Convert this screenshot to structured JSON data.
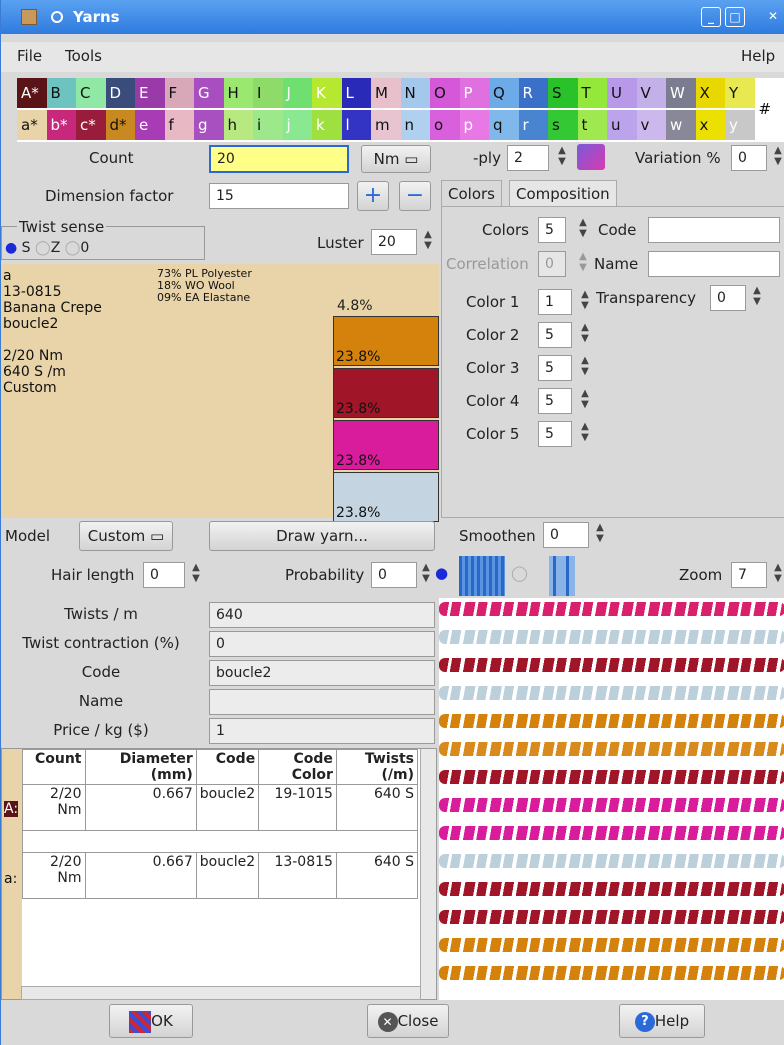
{
  "window": {
    "title": "Yarns"
  },
  "menu": {
    "file": "File",
    "tools": "Tools",
    "help": "Help"
  },
  "palette": {
    "upper": [
      {
        "l": "A*",
        "c": "#5a1418",
        "t": "#fff"
      },
      {
        "l": "B",
        "c": "#6cc3c0",
        "t": "#111"
      },
      {
        "l": "C",
        "c": "#8fe8a4",
        "t": "#111"
      },
      {
        "l": "D",
        "c": "#3a4d7a",
        "t": "#fff"
      },
      {
        "l": "E",
        "c": "#9a3aa8",
        "t": "#fff"
      },
      {
        "l": "F",
        "c": "#d8a8b8",
        "t": "#111"
      },
      {
        "l": "G",
        "c": "#a84ec0",
        "t": "#fff"
      },
      {
        "l": "H",
        "c": "#9ae870",
        "t": "#111"
      },
      {
        "l": "I",
        "c": "#8edb6a",
        "t": "#111"
      },
      {
        "l": "J",
        "c": "#6fe06f",
        "t": "#fff"
      },
      {
        "l": "K",
        "c": "#b6e830",
        "t": "#fff"
      },
      {
        "l": "L",
        "c": "#2a2ab8",
        "t": "#fff"
      },
      {
        "l": "M",
        "c": "#e8c0cc",
        "t": "#111"
      },
      {
        "l": "N",
        "c": "#a4c8ec",
        "t": "#111"
      },
      {
        "l": "O",
        "c": "#d458d8",
        "t": "#111"
      },
      {
        "l": "P",
        "c": "#e070e0",
        "t": "#fff"
      },
      {
        "l": "Q",
        "c": "#6caae8",
        "t": "#111"
      },
      {
        "l": "R",
        "c": "#3a70c8",
        "t": "#fff"
      },
      {
        "l": "S",
        "c": "#2ac22a",
        "t": "#111"
      },
      {
        "l": "T",
        "c": "#94e83a",
        "t": "#111"
      },
      {
        "l": "U",
        "c": "#b898e8",
        "t": "#111"
      },
      {
        "l": "V",
        "c": "#c4b0e8",
        "t": "#111"
      },
      {
        "l": "W",
        "c": "#7c7c90",
        "t": "#fff"
      },
      {
        "l": "X",
        "c": "#e8d800",
        "t": "#111"
      },
      {
        "l": "Y",
        "c": "#e8e850",
        "t": "#111"
      }
    ],
    "lower": [
      {
        "l": "a*",
        "c": "#e8d4a8",
        "t": "#111"
      },
      {
        "l": "b*",
        "c": "#c8287c",
        "t": "#fff"
      },
      {
        "l": "c*",
        "c": "#9a1c3c",
        "t": "#fff"
      },
      {
        "l": "d*",
        "c": "#c88a20",
        "t": "#111"
      },
      {
        "l": "e",
        "c": "#a83cb4",
        "t": "#fff"
      },
      {
        "l": "f",
        "c": "#e8b8c4",
        "t": "#111"
      },
      {
        "l": "g",
        "c": "#a850c0",
        "t": "#fff"
      },
      {
        "l": "h",
        "c": "#b8e880",
        "t": "#111"
      },
      {
        "l": "i",
        "c": "#9ce88a",
        "t": "#111"
      },
      {
        "l": "j",
        "c": "#8ae890",
        "t": "#fff"
      },
      {
        "l": "k",
        "c": "#9ee040",
        "t": "#fff"
      },
      {
        "l": "l",
        "c": "#3434c4",
        "t": "#fff"
      },
      {
        "l": "m",
        "c": "#e8c4d0",
        "t": "#111"
      },
      {
        "l": "n",
        "c": "#b0d0f0",
        "t": "#111"
      },
      {
        "l": "o",
        "c": "#d860dc",
        "t": "#111"
      },
      {
        "l": "p",
        "c": "#e878e4",
        "t": "#fff"
      },
      {
        "l": "q",
        "c": "#80b8ec",
        "t": "#111"
      },
      {
        "l": "r",
        "c": "#4884d0",
        "t": "#fff"
      },
      {
        "l": "s",
        "c": "#34c834",
        "t": "#111"
      },
      {
        "l": "t",
        "c": "#a0e850",
        "t": "#111"
      },
      {
        "l": "u",
        "c": "#bca4ec",
        "t": "#111"
      },
      {
        "l": "v",
        "c": "#ccb8ec",
        "t": "#111"
      },
      {
        "l": "w",
        "c": "#888898",
        "t": "#fff"
      },
      {
        "l": "x",
        "c": "#ece000",
        "t": "#111"
      },
      {
        "l": "y",
        "c": "#c8c8c8",
        "t": "#fff"
      }
    ],
    "hash": "#"
  },
  "top": {
    "count_label": "Count",
    "count_value": "20",
    "unit": "Nm",
    "ply_label": "-ply",
    "ply_value": "2",
    "variation_label": "Variation %",
    "variation_value": "0",
    "dimension_label": "Dimension factor",
    "dimension_value": "15",
    "twist_label": "Twist sense",
    "twist_s": "S",
    "twist_z": "Z",
    "twist_0": "0",
    "luster_label": "Luster",
    "luster_value": "20"
  },
  "info": {
    "lines": [
      "a",
      "13-0815",
      "Banana Crepe",
      "boucle2",
      "",
      "2/20 Nm",
      "640 S /m",
      "Custom"
    ],
    "composition": [
      "73% PL Polyester",
      "18% WO Wool",
      "09% EA Elastane"
    ],
    "bars": [
      {
        "pct": "4.8%",
        "color": "#e8d4a8"
      },
      {
        "pct": "23.8%",
        "color": "#d4820c"
      },
      {
        "pct": "23.8%",
        "color": "#a01628"
      },
      {
        "pct": "23.8%",
        "color": "#d81c9c"
      },
      {
        "pct": "23.8%",
        "color": "#c4d4e0"
      }
    ]
  },
  "tabs": {
    "colors": "Colors",
    "composition": "Composition"
  },
  "colors_tab": {
    "colors_label": "Colors",
    "colors_value": "5",
    "code_label": "Code",
    "code_value": "",
    "correlation_label": "Correlation",
    "correlation_value": "0",
    "name_label": "Name",
    "name_value": "",
    "transparency_label": "Transparency",
    "transparency_value": "0",
    "rows": [
      {
        "label": "Color 1",
        "value": "1"
      },
      {
        "label": "Color 2",
        "value": "5"
      },
      {
        "label": "Color 3",
        "value": "5"
      },
      {
        "label": "Color 4",
        "value": "5"
      },
      {
        "label": "Color 5",
        "value": "5"
      }
    ]
  },
  "model": {
    "label": "Model",
    "value": "Custom",
    "draw": "Draw yarn...",
    "smoothen_label": "Smoothen",
    "smoothen_value": "0"
  },
  "hair": {
    "label": "Hair length",
    "value": "0",
    "prob_label": "Probability",
    "prob_value": "0",
    "zoom_label": "Zoom",
    "zoom_value": "7"
  },
  "props": [
    {
      "label": "Twists / m",
      "value": "640"
    },
    {
      "label": "Twist contraction (%)",
      "value": "0"
    },
    {
      "label": "Code",
      "value": "boucle2"
    },
    {
      "label": "Name",
      "value": ""
    },
    {
      "label": "Price / kg ($)",
      "value": "1"
    }
  ],
  "table": {
    "headers": [
      "Count",
      "Diameter (mm)",
      "Code",
      "Code Color",
      "Twists (/m)"
    ],
    "rows": [
      {
        "key": "A:",
        "count": "2/20 Nm",
        "diameter": "0.667",
        "code": "boucle2",
        "color": "19-1015",
        "twists": "640 S"
      },
      {
        "key": "a:",
        "count": "2/20 Nm",
        "diameter": "0.667",
        "code": "boucle2",
        "color": "13-0815",
        "twists": "640 S"
      }
    ]
  },
  "yarn_preview": {
    "colors": [
      "#d8206c",
      "#bcd0dc",
      "#a01628",
      "#bcd0dc",
      "#d4820c",
      "#d88a1c",
      "#a01628",
      "#d81c9c",
      "#d81c9c",
      "#bcd0dc",
      "#a01628",
      "#a01628",
      "#d4820c",
      "#d4820c"
    ]
  },
  "footer": {
    "ok": "OK",
    "close": "Close",
    "help": "Help"
  }
}
